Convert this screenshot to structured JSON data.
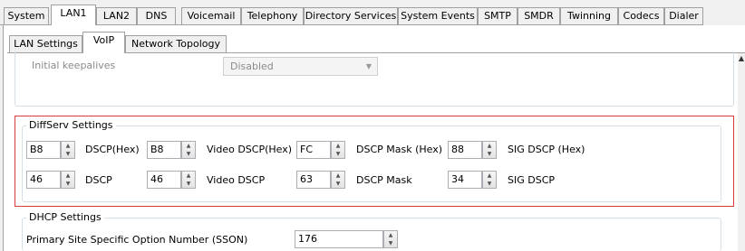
{
  "top_tabs": [
    "System",
    "LAN1",
    "LAN2",
    "DNS",
    "Voicemail",
    "Telephony",
    "Directory Services",
    "System Events",
    "SMTP",
    "SMDR",
    "Twinning",
    "Codecs",
    "Dialer"
  ],
  "sub_tabs": [
    "LAN Settings",
    "VoIP",
    "Network Topology"
  ],
  "initial_keepalives": {
    "label": "Initial keepalives",
    "value": "Disabled"
  },
  "diffserv": {
    "legend": "DiffServ Settings",
    "row1": [
      {
        "value": "B8",
        "label": "DSCP(Hex)"
      },
      {
        "value": "B8",
        "label": "Video DSCP(Hex)"
      },
      {
        "value": "FC",
        "label": "DSCP Mask (Hex)"
      },
      {
        "value": "88",
        "label": "SIG DSCP (Hex)"
      }
    ],
    "row2": [
      {
        "value": "46",
        "label": "DSCP"
      },
      {
        "value": "46",
        "label": "Video DSCP"
      },
      {
        "value": "63",
        "label": "DSCP Mask"
      },
      {
        "value": "34",
        "label": "SIG DSCP"
      }
    ]
  },
  "dhcp": {
    "legend": "DHCP Settings",
    "sson_label": "Primary Site Specific Option Number (SSON)",
    "sson_value": "176"
  },
  "icons": {
    "spin_up": "triangle-up",
    "spin_down": "triangle-down",
    "combo": "chevron-down"
  },
  "colors": {
    "highlight_border": "#d93a3a",
    "selected_tab": "#ffffff"
  }
}
